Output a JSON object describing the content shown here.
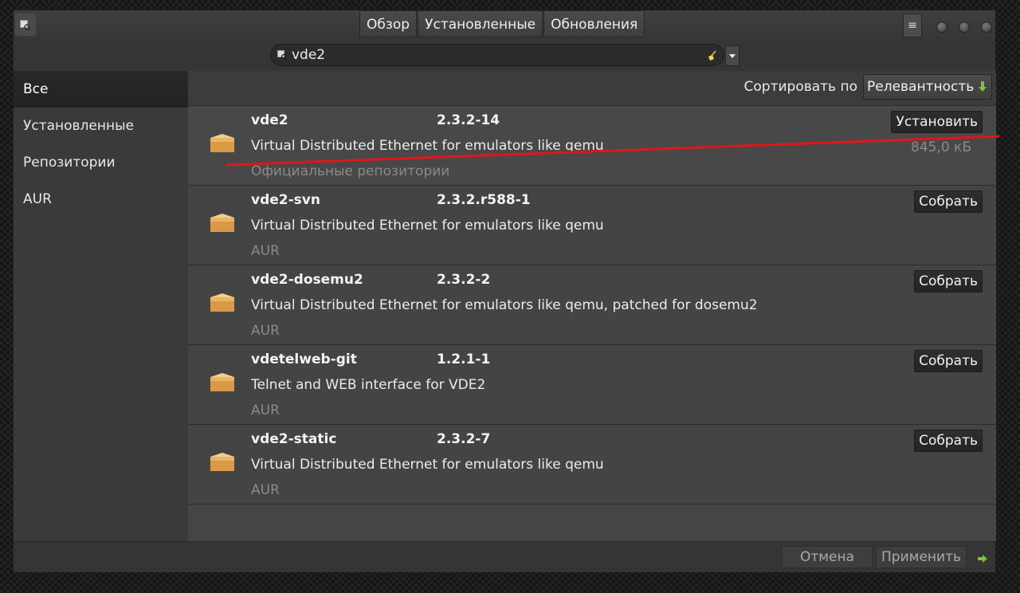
{
  "header": {
    "tabs": [
      {
        "label": "Обзор"
      },
      {
        "label": "Установленные"
      },
      {
        "label": "Обновления"
      }
    ],
    "menu_icon": "hamburger-icon",
    "window_controls": [
      "minimize-icon",
      "maximize-icon",
      "close-icon"
    ]
  },
  "search": {
    "value": "vde2",
    "icon": "search-icon",
    "clear_icon": "clear-broom-icon"
  },
  "sidebar": {
    "items": [
      {
        "label": "Все",
        "active": true
      },
      {
        "label": "Установленные"
      },
      {
        "label": "Репозитории"
      },
      {
        "label": "AUR"
      }
    ]
  },
  "sort": {
    "label": "Сортировать по",
    "value": "Релевантность"
  },
  "packages": [
    {
      "name": "vde2",
      "version": "2.3.2-14",
      "description": "Virtual Distributed Ethernet for emulators like qemu",
      "repo": "Официальные репозитории",
      "size": "845,0 кБ",
      "action": "Установить"
    },
    {
      "name": "vde2-svn",
      "version": "2.3.2.r588-1",
      "description": "Virtual Distributed Ethernet for emulators like qemu",
      "repo": "AUR",
      "size": "",
      "action": "Собрать"
    },
    {
      "name": "vde2-dosemu2",
      "version": "2.3.2-2",
      "description": "Virtual Distributed Ethernet for emulators like qemu, patched for dosemu2",
      "repo": "AUR",
      "size": "",
      "action": "Собрать"
    },
    {
      "name": "vdetelweb-git",
      "version": "1.2.1-1",
      "description": "Telnet and WEB interface for VDE2",
      "repo": "AUR",
      "size": "",
      "action": "Собрать"
    },
    {
      "name": "vde2-static",
      "version": "2.3.2-7",
      "description": "Virtual Distributed Ethernet for emulators like qemu",
      "repo": "AUR",
      "size": "",
      "action": "Собрать"
    }
  ],
  "footer": {
    "cancel_label": "Отмена",
    "apply_label": "Применить"
  },
  "colors": {
    "annotation_line": "#e0161b",
    "accent_green": "#7cc242"
  }
}
